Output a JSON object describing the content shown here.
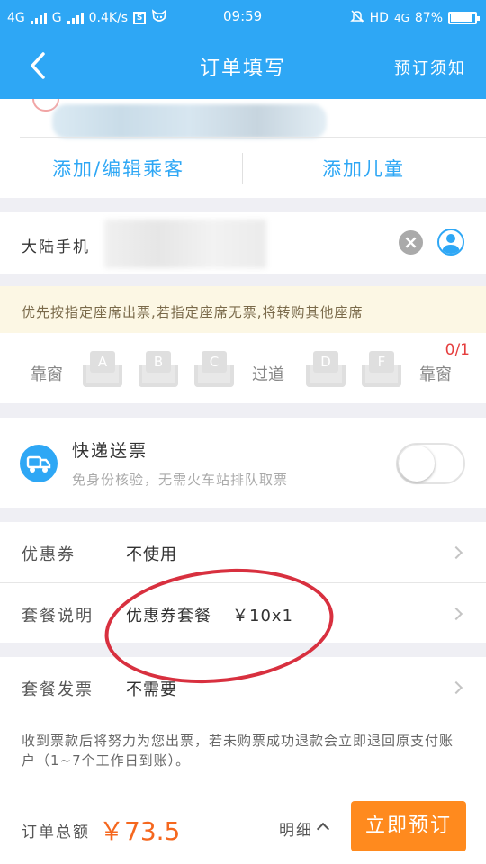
{
  "status_bar": {
    "network_1": "4G",
    "network_2": "G",
    "speed": "0.4K/s",
    "time": "09:59",
    "hd": "HD",
    "network_3": "4G",
    "battery": "87%"
  },
  "nav": {
    "title": "订单填写",
    "notice": "预订须知"
  },
  "passenger": {
    "add_edit": "添加/编辑乘客",
    "add_child": "添加儿童"
  },
  "phone": {
    "label": "大陆手机"
  },
  "seat": {
    "notice": "优先按指定座席出票,若指定座席无票,将转购其他座席",
    "count": "0/1",
    "window_left": "靠窗",
    "aisle": "过道",
    "window_right": "靠窗",
    "seats": [
      "A",
      "B",
      "C",
      "D",
      "F"
    ]
  },
  "delivery": {
    "title": "快递送票",
    "subtitle": "免身份核验，无需火车站排队取票",
    "enabled": false
  },
  "coupon": {
    "label": "优惠券",
    "value": "不使用"
  },
  "package": {
    "label": "套餐说明",
    "name": "优惠券套餐",
    "price": "￥10x1"
  },
  "invoice": {
    "label": "套餐发票",
    "value": "不需要"
  },
  "note": {
    "text": "收到票款后将努力为您出票，若未购票成功退款会立即退回原支付账户（1~7个工作日到账）。"
  },
  "bottom": {
    "total_label": "订单总额",
    "total_amount": "￥73.5",
    "detail_label": "明细",
    "book_button": "立即预订"
  },
  "colors": {
    "primary": "#2ea7f5",
    "accent_orange": "#ff8a1e",
    "price_orange": "#f5671e",
    "annotation_red": "#d8303f"
  }
}
